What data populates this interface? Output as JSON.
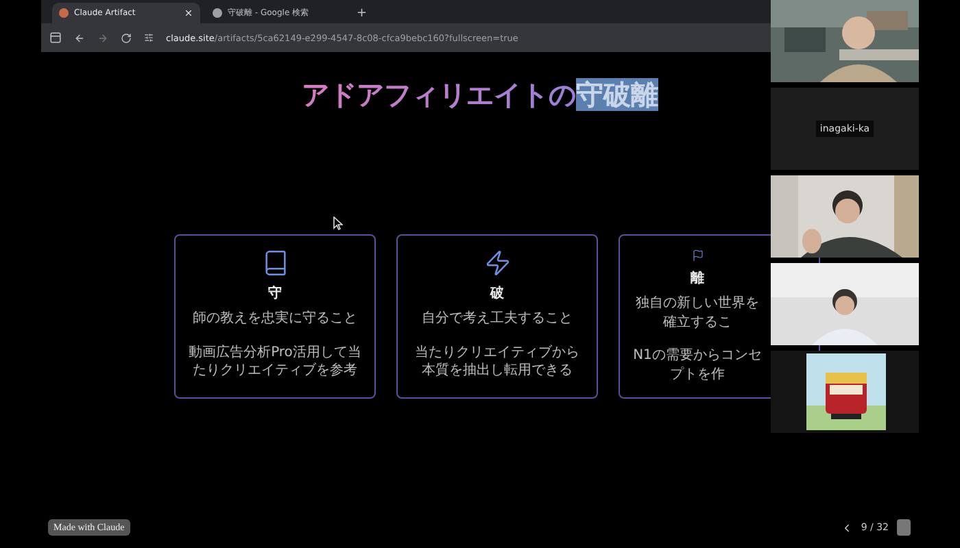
{
  "browser": {
    "tabs": [
      {
        "title": "Claude Artifact",
        "selected": true
      },
      {
        "title": "守破離 - Google 検索",
        "selected": false
      }
    ],
    "new_tab": "+",
    "url_host": "claude.site",
    "url_path": "/artifacts/5ca62149-e299-4547-8c08-cfca9bebc160?fullscreen=true"
  },
  "slide": {
    "title": [
      {
        "text": "アドアフィリエイトの",
        "highlighted": false
      },
      {
        "text": "守破離",
        "highlighted": true
      }
    ],
    "cards": [
      {
        "kind": "book",
        "title": "守",
        "description": "師の教えを忠実に守ること",
        "example": "動画広告分析Pro活用して当たりクリエイティブを参考"
      },
      {
        "kind": "bolt",
        "title": "破",
        "description": "自分で考え工夫すること",
        "example": "当たりクリエイティブから本質を抽出し転用できる"
      },
      {
        "kind": "flag",
        "title": "離",
        "description": "独自の新しい世界を確立するこ",
        "example": "N1の需要からコンセプトを作"
      }
    ]
  },
  "footer": {
    "badge": "Made with Claude",
    "page": "9 / 32"
  },
  "participants": [
    {
      "kind": "picture"
    },
    {
      "kind": "name",
      "name": "inagaki-ka"
    },
    {
      "kind": "picture"
    },
    {
      "kind": "picture"
    },
    {
      "kind": "picture"
    }
  ]
}
